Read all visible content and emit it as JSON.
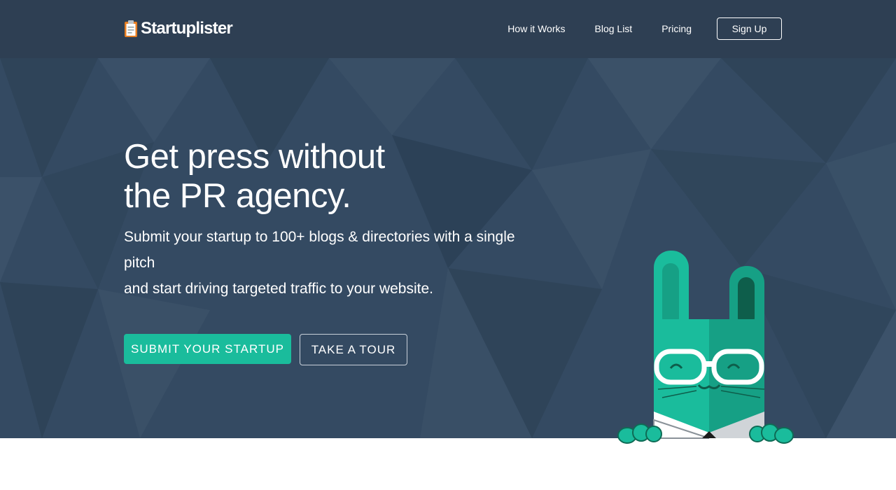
{
  "brand": {
    "name": "Startuplister"
  },
  "nav": {
    "links": [
      "How it Works",
      "Blog List",
      "Pricing"
    ],
    "signup_label": "Sign Up"
  },
  "hero": {
    "headline_line1": "Get press without",
    "headline_line2": "the PR agency.",
    "subhead_line1": "Submit your startup to 100+ blogs & directories with a single pitch",
    "subhead_line2": "and start driving targeted traffic to your website.",
    "primary_cta": "SUBMIT YOUR STARTUP",
    "secondary_cta": "TAKE A TOUR"
  },
  "icons": {
    "logo": "clipboard-icon",
    "mascot": "rabbit-mascot-with-glasses"
  },
  "colors": {
    "navbar": "#2e3f53",
    "hero_background": "#344a62",
    "accent": "#1abc9c",
    "text": "#ffffff"
  }
}
